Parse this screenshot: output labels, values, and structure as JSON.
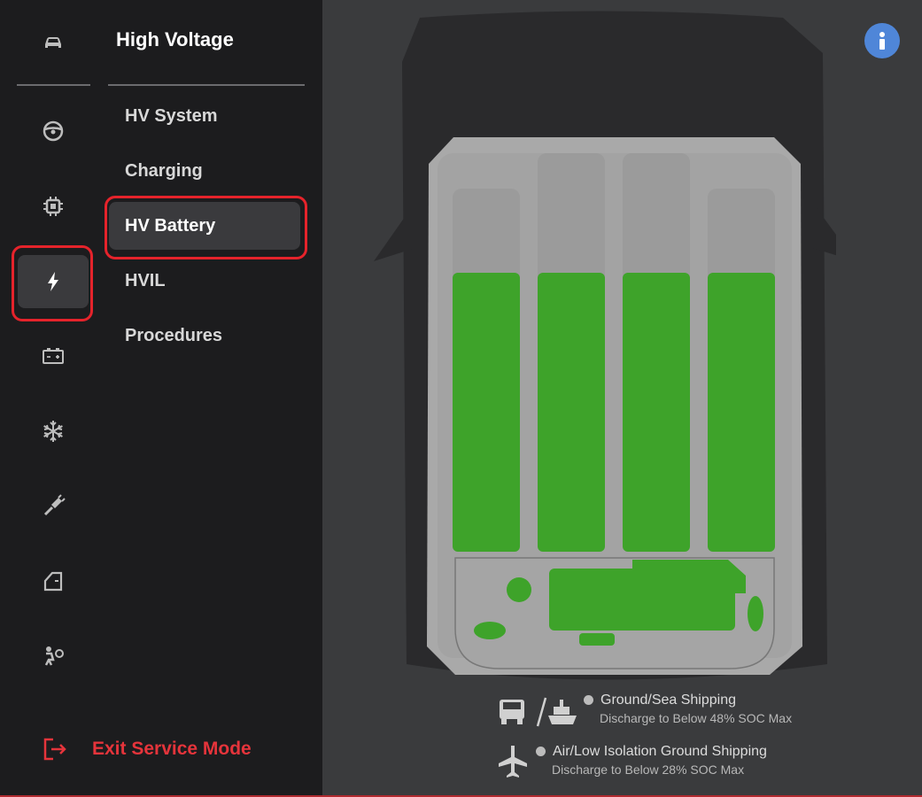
{
  "rail": {
    "items": [
      {
        "icon": "car-icon"
      },
      {
        "icon": "steering-wheel-icon"
      },
      {
        "icon": "chip-icon"
      },
      {
        "icon": "lightning-icon",
        "active": true
      },
      {
        "icon": "battery-icon"
      },
      {
        "icon": "snowflake-icon"
      },
      {
        "icon": "wrench-icon"
      },
      {
        "icon": "door-icon"
      },
      {
        "icon": "airbag-icon"
      }
    ]
  },
  "menu": {
    "title": "High Voltage",
    "items": [
      {
        "label": "HV System"
      },
      {
        "label": "Charging"
      },
      {
        "label": "HV Battery",
        "active": true
      },
      {
        "label": "HVIL"
      },
      {
        "label": "Procedures"
      }
    ]
  },
  "exit": {
    "label": "Exit Service Mode"
  },
  "legend": {
    "ground": {
      "title": "Ground/Sea Shipping",
      "subtitle": "Discharge to Below 48% SOC Max"
    },
    "air": {
      "title": "Air/Low Isolation Ground Shipping",
      "subtitle": "Discharge to Below 28% SOC Max"
    }
  },
  "colors": {
    "accent": "#e5232b",
    "battery_green": "#3ea32a",
    "info_blue": "#4f86d8"
  }
}
